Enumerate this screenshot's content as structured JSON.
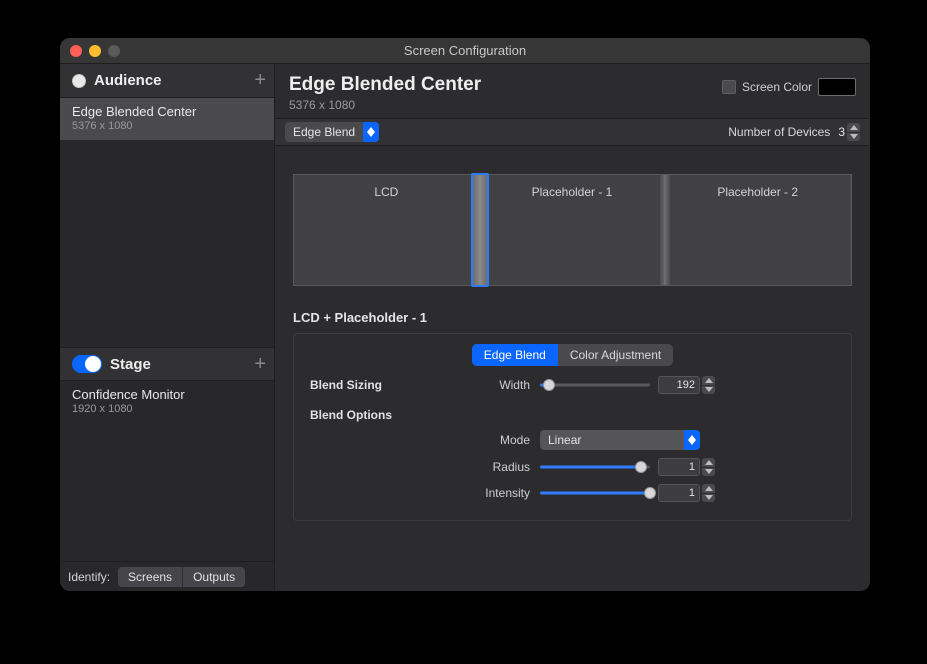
{
  "window": {
    "title": "Screen Configuration"
  },
  "sidebar": {
    "sections": [
      {
        "label": "Audience",
        "toggled": false
      },
      {
        "label": "Stage",
        "toggled": true
      }
    ],
    "audience_items": [
      {
        "name": "Edge Blended Center",
        "resolution": "5376 x 1080"
      }
    ],
    "stage_items": [
      {
        "name": "Confidence Monitor",
        "resolution": "1920 x 1080"
      }
    ],
    "identify": {
      "label": "Identify:",
      "options": [
        "Screens",
        "Outputs"
      ]
    }
  },
  "main": {
    "title": "Edge Blended Center",
    "resolution": "5376 x 1080",
    "screen_color_label": "Screen Color",
    "mode_dropdown": "Edge Blend",
    "devices": {
      "label": "Number of Devices",
      "value": "3"
    },
    "preview_panels": [
      "LCD",
      "Placeholder - 1",
      "Placeholder - 2"
    ],
    "controls": {
      "title": "LCD + Placeholder - 1",
      "tabs": [
        "Edge Blend",
        "Color Adjustment"
      ],
      "groups": {
        "sizing_label": "Blend Sizing",
        "options_label": "Blend Options",
        "width": {
          "label": "Width",
          "value": "192"
        },
        "mode": {
          "label": "Mode",
          "value": "Linear"
        },
        "radius": {
          "label": "Radius",
          "value": "1"
        },
        "intensity": {
          "label": "Intensity",
          "value": "1"
        }
      }
    }
  }
}
